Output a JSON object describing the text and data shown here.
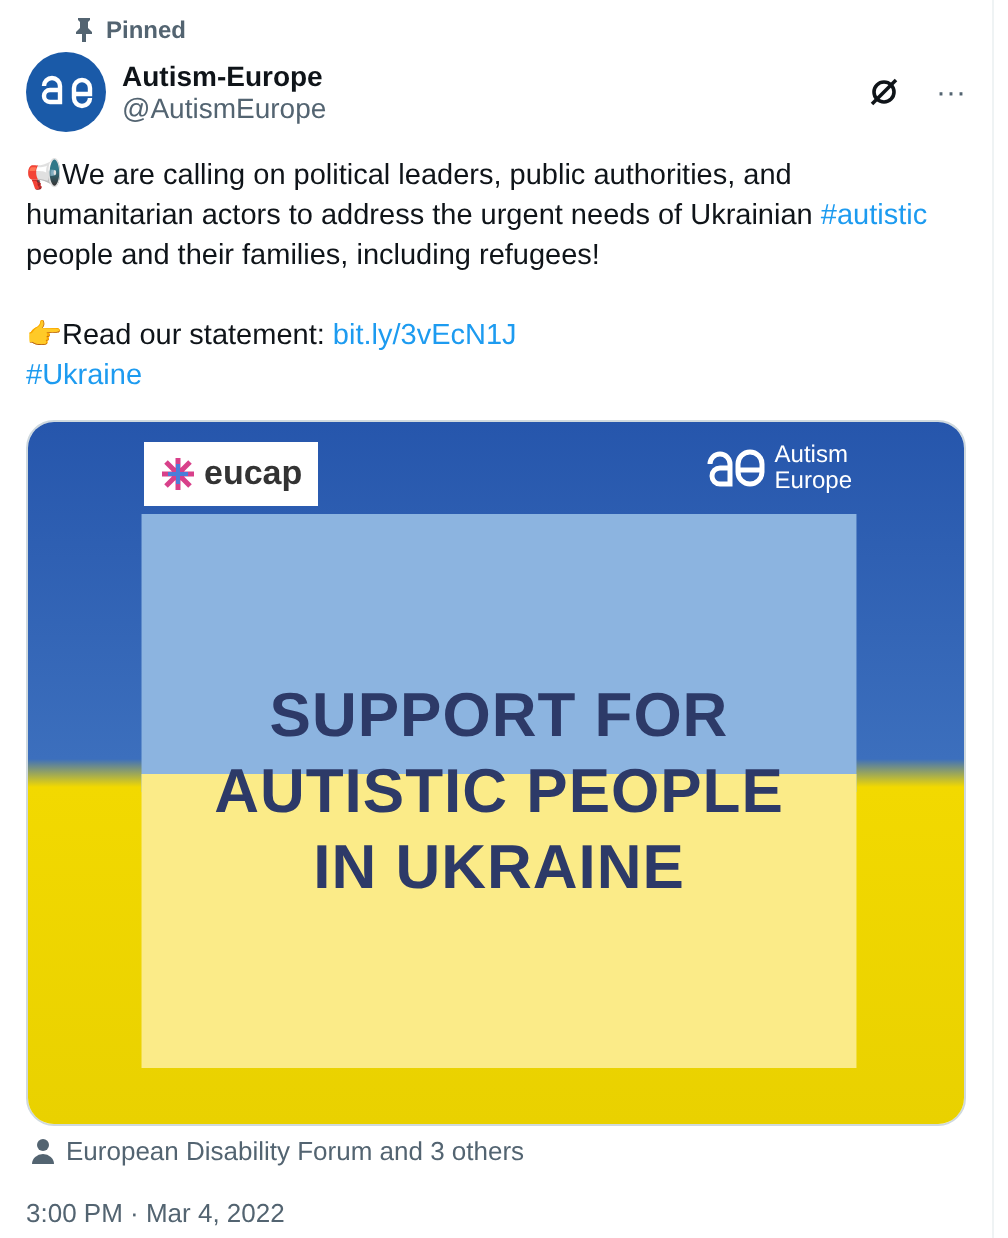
{
  "pinned": "Pinned",
  "author": {
    "name": "Autism-Europe",
    "handle": "@AutismEurope"
  },
  "more": "···",
  "body": [
    {
      "kind": "line",
      "parts": [
        {
          "kind": "text",
          "text": "📢We are calling on political leaders, public authorities, and humanitarian actors to address the urgent needs of Ukrainian "
        },
        {
          "kind": "link",
          "text": "#autistic"
        },
        {
          "kind": "text",
          "text": " people and their families, including refugees!"
        }
      ]
    },
    {
      "kind": "line",
      "parts": [
        {
          "kind": "text",
          "text": "👉Read our statement: "
        },
        {
          "kind": "link",
          "text": "bit.ly/3vEcN1J"
        }
      ]
    },
    {
      "kind": "line",
      "parts": [
        {
          "kind": "link",
          "text": "#Ukraine"
        }
      ]
    }
  ],
  "media": {
    "logo_left": "eucap",
    "logo_right": [
      "Autism",
      "Europe"
    ],
    "headline": [
      "SUPPORT FOR",
      "AUTISTIC PEOPLE",
      "IN UKRAINE"
    ]
  },
  "tagged": "European Disability Forum and 3 others",
  "timestamp": "3:00 PM · Mar 4, 2022"
}
